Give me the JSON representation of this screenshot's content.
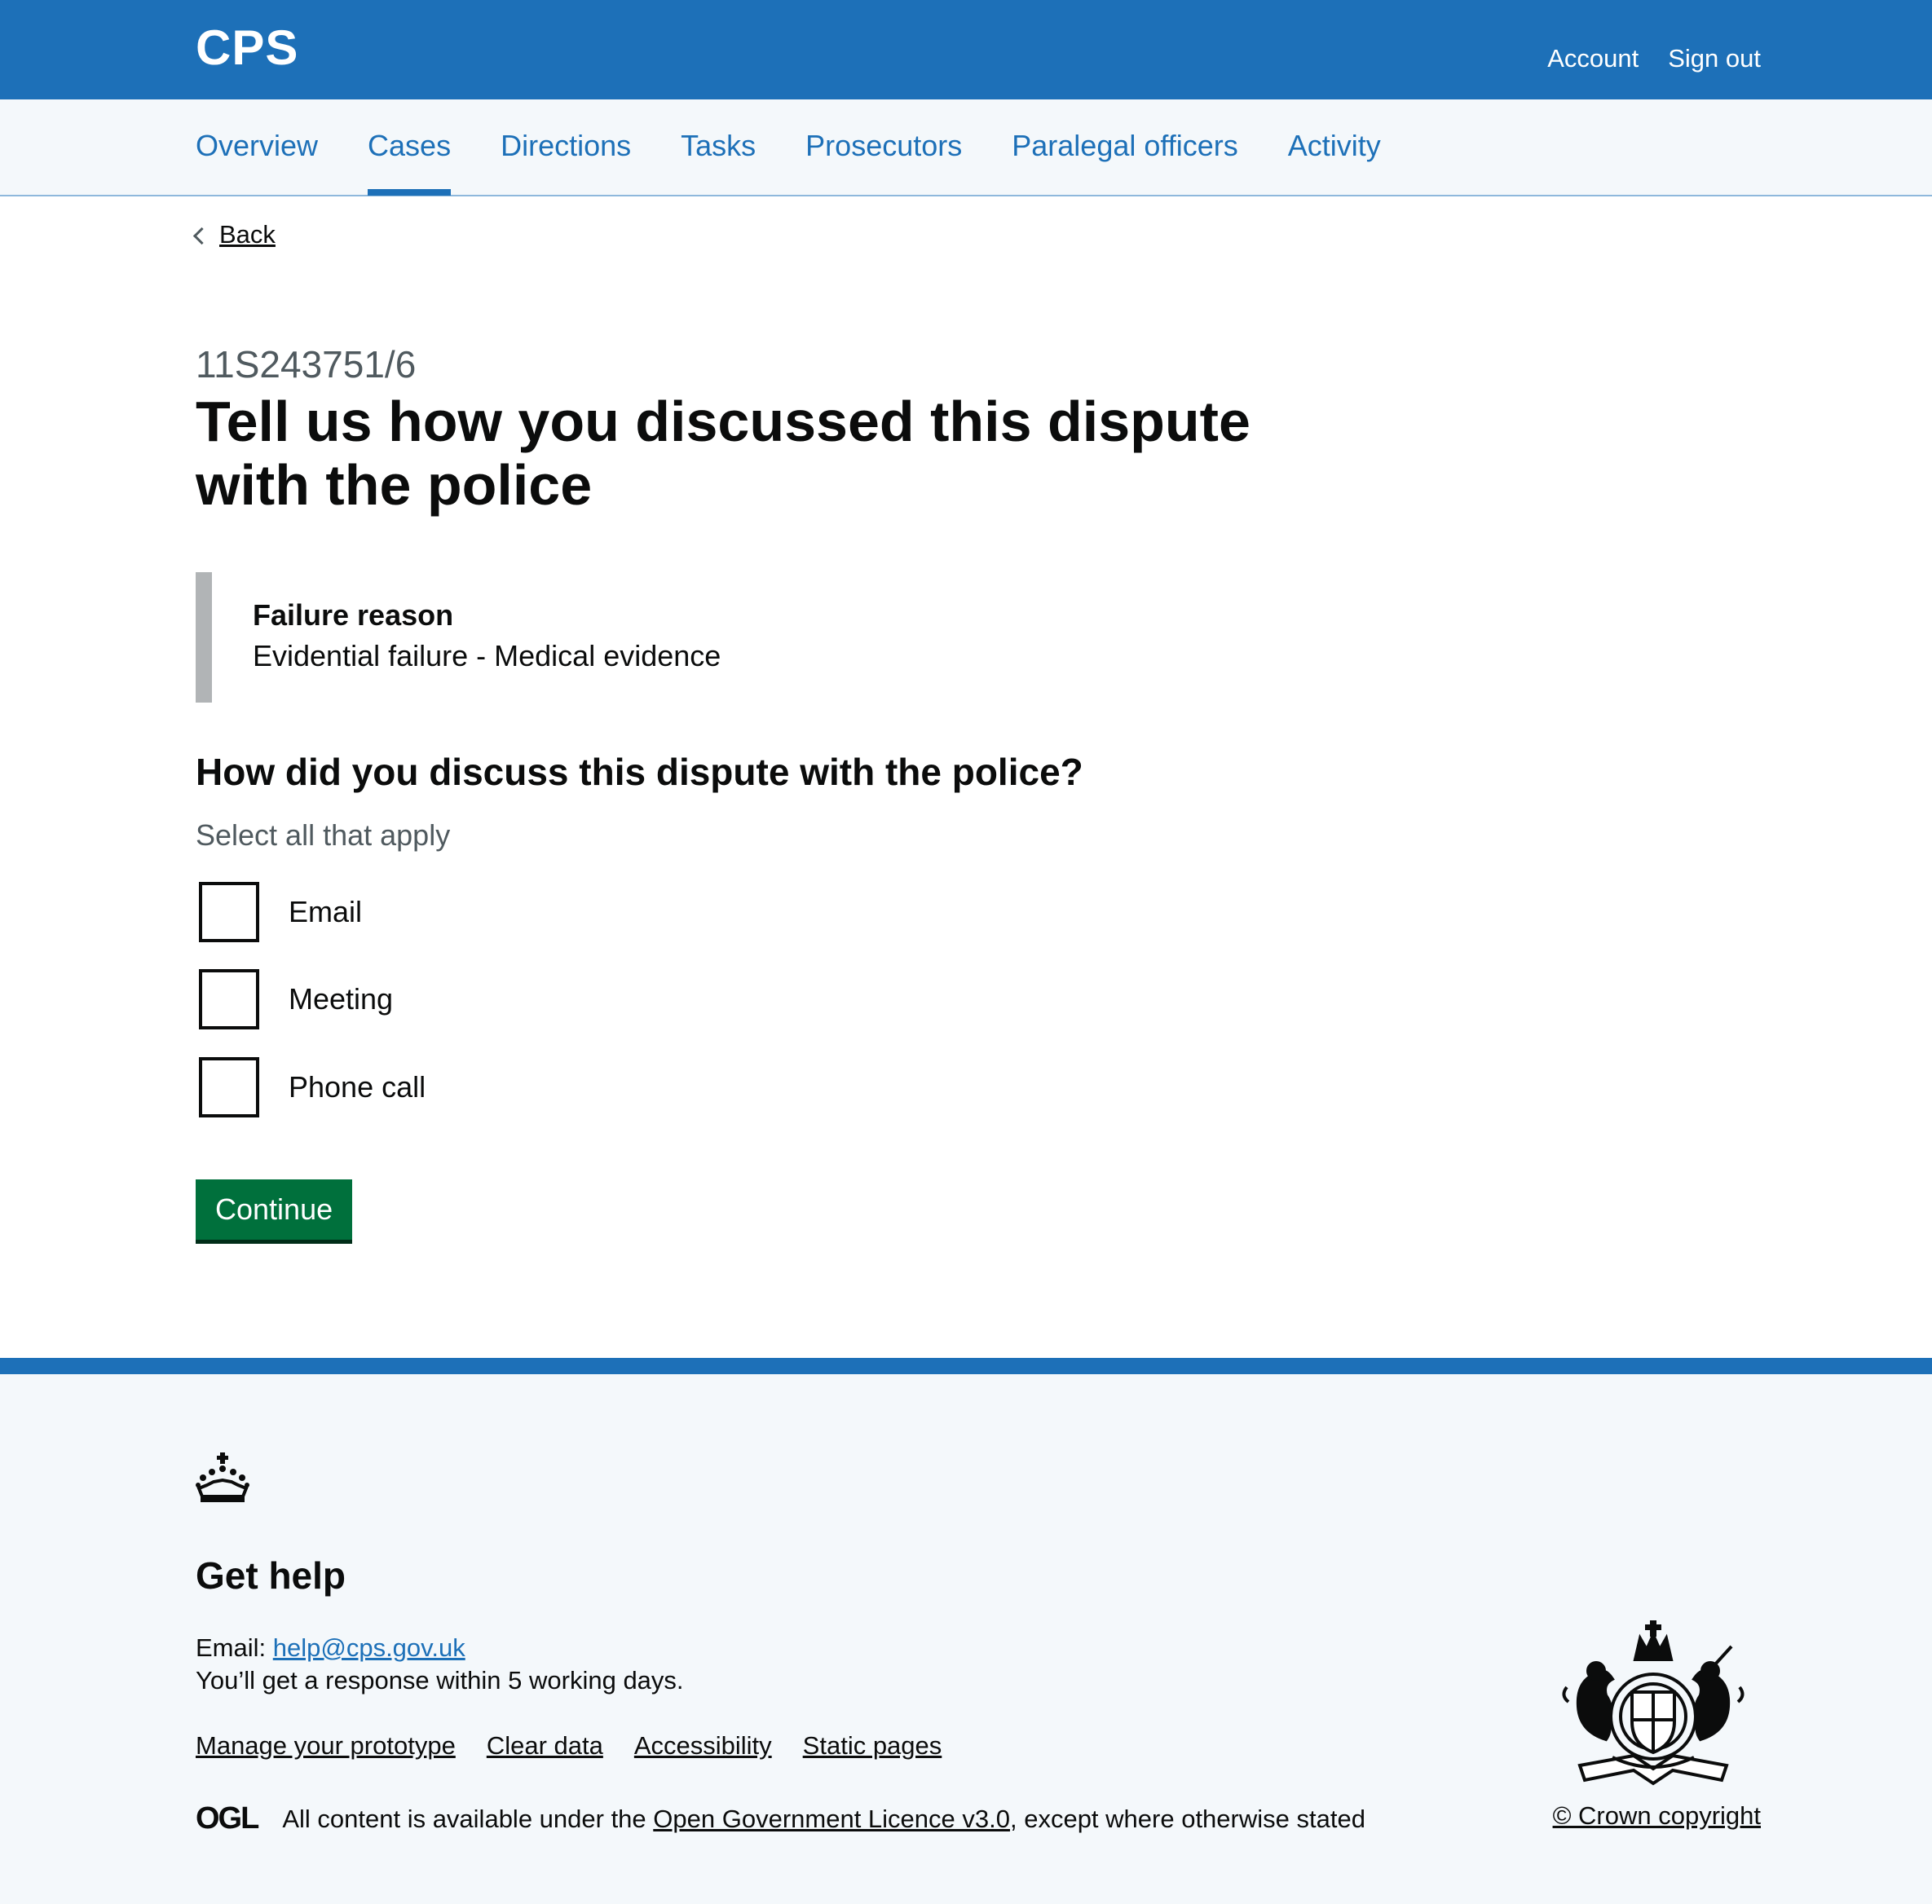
{
  "header": {
    "logo": "CPS",
    "account_link": "Account",
    "signout_link": "Sign out"
  },
  "nav": {
    "items": [
      {
        "label": "Overview"
      },
      {
        "label": "Cases"
      },
      {
        "label": "Directions"
      },
      {
        "label": "Tasks"
      },
      {
        "label": "Prosecutors"
      },
      {
        "label": "Paralegal officers"
      },
      {
        "label": "Activity"
      }
    ],
    "active": "Cases"
  },
  "back_link": "Back",
  "page": {
    "caption": "11S243751/6",
    "title": "Tell us how you discussed this dispute with the police"
  },
  "inset": {
    "title": "Failure reason",
    "text": "Evidential failure - Medical evidence"
  },
  "question": {
    "legend": "How did you discuss this dispute with the police?",
    "hint": "Select all that apply",
    "options": [
      {
        "label": "Email",
        "checked": false
      },
      {
        "label": "Meeting",
        "checked": false
      },
      {
        "label": "Phone call",
        "checked": false
      }
    ]
  },
  "continue_button": "Continue",
  "footer": {
    "heading": "Get help",
    "email_label": "Email: ",
    "email": "help@cps.gov.uk",
    "response_text": "You’ll get a response within 5 working days.",
    "links": [
      {
        "label": "Manage your prototype"
      },
      {
        "label": "Clear data"
      },
      {
        "label": "Accessibility"
      },
      {
        "label": "Static pages"
      }
    ],
    "ogl_logo": "OGL",
    "licence_prefix": "All content is available under the ",
    "licence_link": "Open Government Licence v3.0",
    "licence_suffix": ", except where otherwise stated",
    "copyright": "© Crown copyright"
  },
  "colors": {
    "brand_blue": "#1d70b8",
    "button_green": "#00703c",
    "text": "#0b0c0c",
    "secondary_text": "#505a5f",
    "nav_background": "#f4f8fb"
  }
}
